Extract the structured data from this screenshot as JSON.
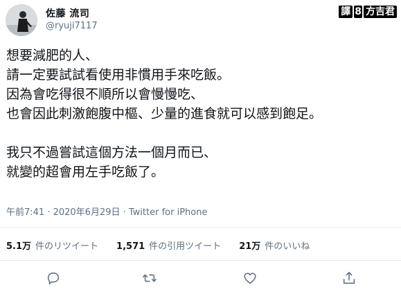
{
  "header": {
    "display_name": "佐藤 流司",
    "username": "@ryuji7117",
    "avatar_icon": "profile-photo-icon"
  },
  "watermark": {
    "label": "譯",
    "separator": "8",
    "name": "方吉君"
  },
  "tweet": {
    "lines": [
      "想要減肥的人、",
      "請一定要試試看使用非慣用手來吃飯。",
      "因為會吃得很不順所以會慢慢吃、",
      "也會因此刺激飽腹中樞、少量的進食就可以感到飽足。",
      "",
      "我只不過嘗試這個方法一個月而已、",
      "就變的超會用左手吃飯了。"
    ]
  },
  "meta": {
    "text": "午前7:41 · 2020年6月29日 · Twitter for iPhone"
  },
  "stats": {
    "retweets_count": "5.1万",
    "retweets_label": "件のリツイート",
    "quotes_count": "1,571",
    "quotes_label": "件の引用ツイート",
    "likes_count": "21万",
    "likes_label": "件のいいね"
  },
  "actions": {
    "icons": [
      "reply-icon",
      "retweet-icon",
      "like-icon",
      "share-icon"
    ]
  },
  "colors": {
    "text_primary": "#0f1419",
    "text_secondary": "#5b7083",
    "divider": "#e6ecf0",
    "background": "#ffffff"
  }
}
